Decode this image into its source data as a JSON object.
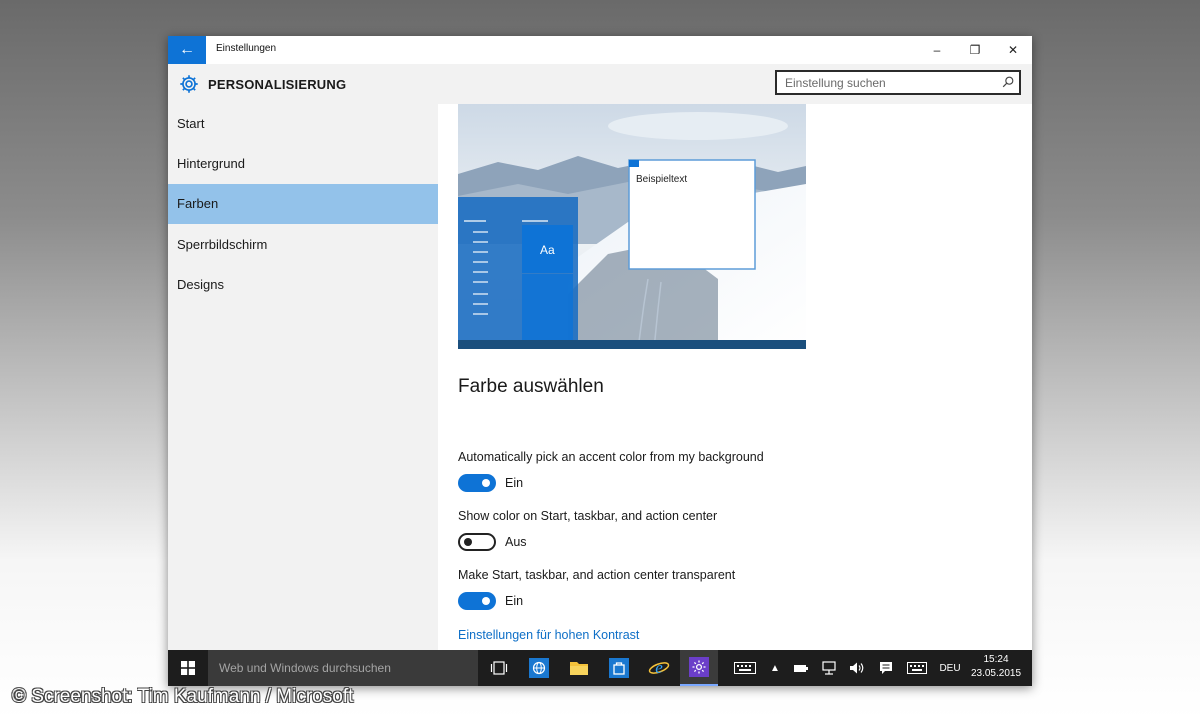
{
  "window": {
    "title": "Einstellungen",
    "back_icon": "arrow-left-icon",
    "minimize_glyph": "–",
    "maximize_glyph": "❐",
    "close_glyph": "✕"
  },
  "header": {
    "title": "PERSONALISIERUNG",
    "icon": "gear-icon",
    "search_placeholder": "Einstellung suchen"
  },
  "sidebar": {
    "items": [
      {
        "label": "Start",
        "active": false
      },
      {
        "label": "Hintergrund",
        "active": false
      },
      {
        "label": "Farben",
        "active": true
      },
      {
        "label": "Sperrbildschirm",
        "active": false
      },
      {
        "label": "Designs",
        "active": false
      }
    ]
  },
  "preview": {
    "sample_text": "Beispieltext",
    "tile_label": "Aa"
  },
  "colors_section": {
    "heading": "Farbe auswählen",
    "options": [
      {
        "label": "Automatically pick an accent color from my background",
        "state": "Ein",
        "on": true
      },
      {
        "label": "Show color on Start, taskbar, and action center",
        "state": "Aus",
        "on": false
      },
      {
        "label": "Make Start, taskbar, and action center transparent",
        "state": "Ein",
        "on": true
      }
    ],
    "link": "Einstellungen für hohen Kontrast"
  },
  "taskbar": {
    "search_placeholder": "Web und Windows durchsuchen",
    "language": "DEU",
    "time": "15:24",
    "date": "23.05.2015"
  },
  "footer": {
    "copyright": "© Screenshot: Tim Kaufmann / Microsoft"
  },
  "colors": {
    "accent": "#0e73d6",
    "selected_nav": "#93c2ea",
    "link": "#0e6fc7",
    "taskbar": "#1d1d1d"
  }
}
